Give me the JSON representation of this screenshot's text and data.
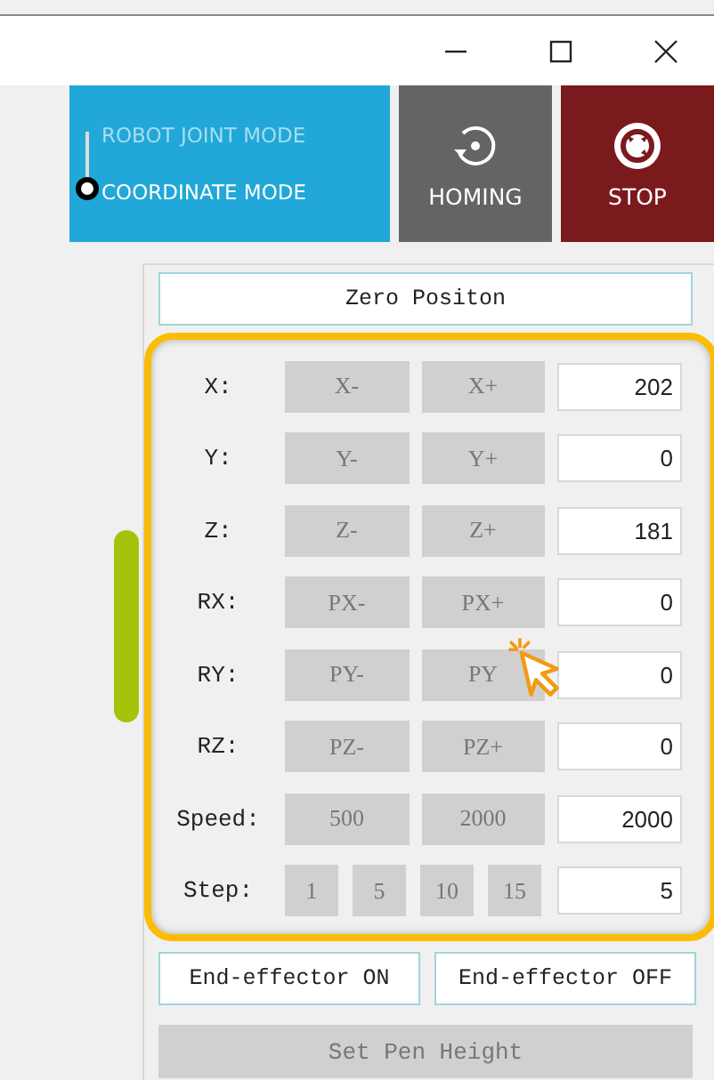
{
  "window": {
    "controls": [
      {
        "kind": "minimize"
      },
      {
        "kind": "maximize"
      },
      {
        "kind": "close"
      }
    ]
  },
  "modes": [
    {
      "label": "ROBOT JOINT MODE",
      "selected": false
    },
    {
      "label": "COORDINATE MODE",
      "selected": true
    }
  ],
  "actions": [
    {
      "kind": "homing",
      "label": "HOMING"
    },
    {
      "kind": "stop",
      "label": "STOP"
    }
  ],
  "zero_button": "Zero Positon",
  "rows": [
    {
      "label": "X:",
      "buttons": [
        {
          "label": "X-",
          "disabled": true
        },
        {
          "label": "X+",
          "disabled": true
        }
      ],
      "value": "202"
    },
    {
      "label": "Y:",
      "buttons": [
        {
          "label": "Y-",
          "disabled": true
        },
        {
          "label": "Y+",
          "disabled": true
        }
      ],
      "value": "0"
    },
    {
      "label": "Z:",
      "buttons": [
        {
          "label": "Z-",
          "disabled": true
        },
        {
          "label": "Z+",
          "disabled": true
        }
      ],
      "value": "181"
    },
    {
      "label": "RX:",
      "buttons": [
        {
          "label": "PX-",
          "disabled": true
        },
        {
          "label": "PX+",
          "disabled": true
        }
      ],
      "value": "0"
    },
    {
      "label": "RY:",
      "buttons": [
        {
          "label": "PY-",
          "disabled": true
        },
        {
          "label": "PY",
          "disabled": true
        }
      ],
      "value": "0"
    },
    {
      "label": "RZ:",
      "buttons": [
        {
          "label": "PZ-",
          "disabled": true
        },
        {
          "label": "PZ+",
          "disabled": true
        }
      ],
      "value": "0"
    },
    {
      "label": "Speed:",
      "buttons": [
        {
          "label": "500",
          "disabled": true
        },
        {
          "label": "2000",
          "disabled": true
        }
      ],
      "value": "2000"
    },
    {
      "label": "Step:",
      "buttons": [
        {
          "label": "1",
          "disabled": true
        },
        {
          "label": "5",
          "disabled": true
        },
        {
          "label": "10",
          "disabled": true
        },
        {
          "label": "15",
          "disabled": true
        }
      ],
      "value": "5"
    }
  ],
  "end_effector": [
    {
      "label": "End-effector ON",
      "disabled": false
    },
    {
      "label": "End-effector OFF",
      "disabled": false
    }
  ],
  "pen_button": {
    "label": "Set Pen Height",
    "disabled": true
  }
}
